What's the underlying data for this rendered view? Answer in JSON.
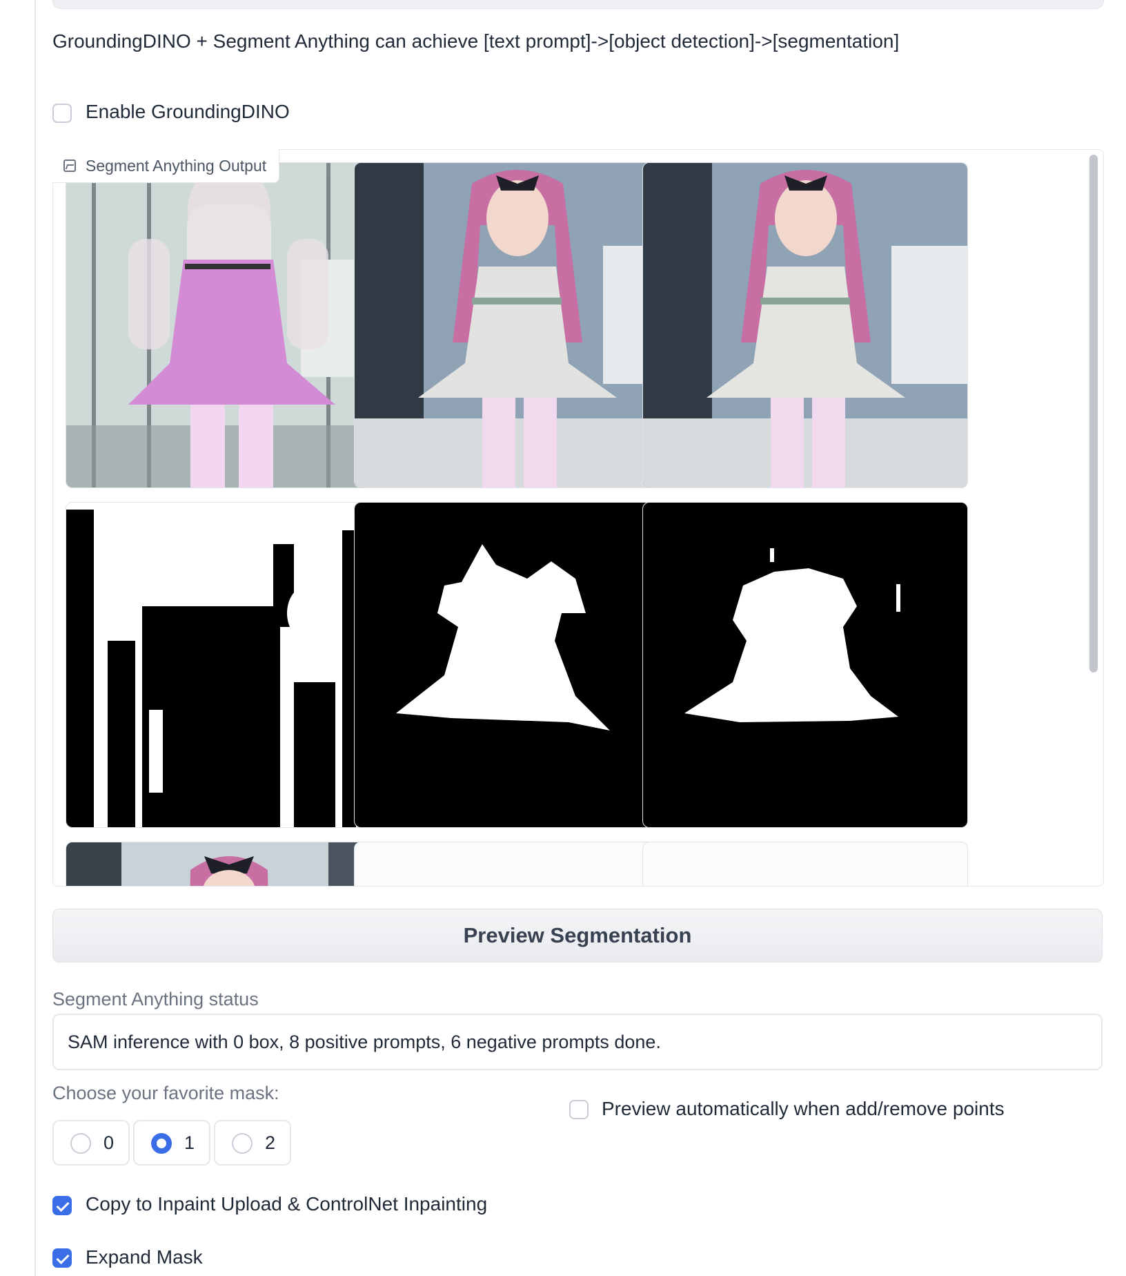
{
  "description": "GroundingDINO + Segment Anything can achieve [text prompt]->[object detection]->[segmentation]",
  "enable_groundingdino": {
    "label": "Enable GroundingDINO",
    "checked": false
  },
  "gallery": {
    "label": "Segment Anything Output",
    "items": [
      "result-image-0",
      "result-image-1",
      "result-image-2",
      "mask-0",
      "mask-1",
      "mask-2",
      "masked-image-0",
      "masked-image-1",
      "masked-image-2"
    ]
  },
  "preview_button": "Preview Segmentation",
  "status": {
    "label": "Segment Anything status",
    "value": "SAM inference with 0 box, 8 positive prompts, 6 negative prompts done."
  },
  "mask_choice": {
    "label": "Choose your favorite mask:",
    "options": [
      "0",
      "1",
      "2"
    ],
    "selected": "1"
  },
  "auto_preview": {
    "label": "Preview automatically when add/remove points",
    "checked": false
  },
  "copy_inpaint": {
    "label": "Copy to Inpaint Upload & ControlNet Inpainting",
    "checked": true
  },
  "expand_mask": {
    "label": "Expand Mask",
    "checked": true
  },
  "colors": {
    "accent": "#3b6ee6",
    "border": "#e5e7eb"
  }
}
